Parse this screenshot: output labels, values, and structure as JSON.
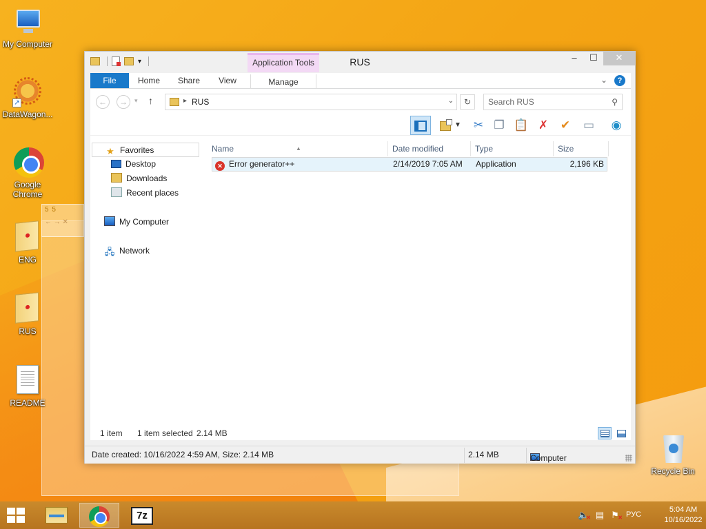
{
  "desktop": {
    "icons": [
      {
        "label": "My Computer"
      },
      {
        "label": "DataWagon..."
      },
      {
        "label": "Google Chrome"
      },
      {
        "label": "ENG"
      },
      {
        "label": "RUS"
      },
      {
        "label": "README"
      },
      {
        "label": "Recycle Bin"
      }
    ],
    "ghost_window_title": "5 5"
  },
  "window": {
    "title": "RUS",
    "contextual_tab_group": "Application Tools",
    "controls": {
      "minimize": "–",
      "maximize": "☐",
      "close": "✕"
    }
  },
  "ribbon": {
    "tabs": [
      {
        "label": "File"
      },
      {
        "label": "Home"
      },
      {
        "label": "Share"
      },
      {
        "label": "View"
      },
      {
        "label": "Manage"
      }
    ],
    "help": "?"
  },
  "address": {
    "path": "RUS",
    "search_placeholder": "Search RUS"
  },
  "toolbar": {
    "icons": [
      "preview-pane-icon",
      "folder-options-icon",
      "cut-icon",
      "copy-icon",
      "paste-icon",
      "delete-icon",
      "check-icon",
      "rename-icon",
      "globe-icon"
    ]
  },
  "nav_pane": {
    "favorites": "Favorites",
    "favorites_items": [
      {
        "label": "Desktop"
      },
      {
        "label": "Downloads"
      },
      {
        "label": "Recent places"
      }
    ],
    "my_computer": "My Computer",
    "network": "Network"
  },
  "file_list": {
    "columns": [
      "Name",
      "Date modified",
      "Type",
      "Size"
    ],
    "rows": [
      {
        "name": "Error generator++",
        "date_modified": "2/14/2019 7:05 AM",
        "type": "Application",
        "size": "2,196 KB"
      }
    ]
  },
  "status": {
    "item_count": "1 item",
    "selected": "1 item selected",
    "selected_size": "2.14 MB"
  },
  "details_bar": {
    "info": "Date created: 10/16/2022 4:59 AM, Size: 2.14 MB",
    "size": "2.14 MB",
    "location": "Computer"
  },
  "taskbar": {
    "language": "РУС",
    "time": "5:04 AM",
    "date": "10/16/2022",
    "zip_label": "7z"
  },
  "colors": {
    "ribbon_file_tab": "#1979ca",
    "context_tab": "#f3d9f5",
    "selection": "#e5f3fb",
    "desktop_bg": "#f4a414"
  }
}
